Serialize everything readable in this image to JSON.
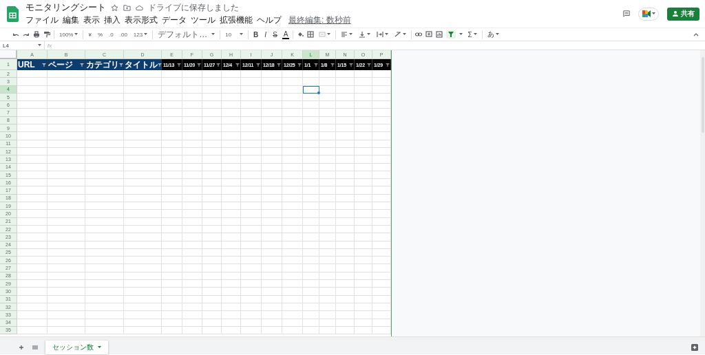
{
  "document": {
    "title": "モニタリングシート",
    "save_status": "ドライブに保存しました",
    "last_edit": "最終編集: 数秒前"
  },
  "menu": [
    "ファイル",
    "編集",
    "表示",
    "挿入",
    "表示形式",
    "データ",
    "ツール",
    "拡張機能",
    "ヘルプ"
  ],
  "share_button": "共有",
  "toolbar": {
    "zoom": "100%",
    "currency": "¥",
    "percent": "%",
    "decrease_decimal": ".0",
    "increase_decimal": ".00",
    "more_formats": "123",
    "font": "デフォルト…",
    "font_size": "10",
    "bold": "B",
    "italic": "I",
    "strikethrough": "S",
    "text_color": "A",
    "functions": "Σ",
    "input_tools": "あ",
    "filter_selected": true
  },
  "name_box": "L4",
  "formula_label": "fx",
  "columns": [
    {
      "label": "A",
      "selected": false
    },
    {
      "label": "B",
      "selected": false
    },
    {
      "label": "C",
      "selected": false
    },
    {
      "label": "D",
      "selected": false
    },
    {
      "label": "E",
      "selected": false
    },
    {
      "label": "F",
      "selected": false
    },
    {
      "label": "G",
      "selected": false
    },
    {
      "label": "H",
      "selected": false
    },
    {
      "label": "I",
      "selected": false
    },
    {
      "label": "J",
      "selected": false
    },
    {
      "label": "K",
      "selected": false
    },
    {
      "label": "L",
      "selected": true
    },
    {
      "label": "M",
      "selected": false
    },
    {
      "label": "N",
      "selected": false
    },
    {
      "label": "O",
      "selected": false
    },
    {
      "label": "P",
      "selected": false
    }
  ],
  "header_row": [
    {
      "text": "URL",
      "kind": "blue"
    },
    {
      "text": "ページ",
      "kind": "blue"
    },
    {
      "text": "カテゴリ",
      "kind": "blue"
    },
    {
      "text": "タイトル",
      "kind": "blue"
    },
    {
      "text": "11/13",
      "kind": "black"
    },
    {
      "text": "11/20",
      "kind": "black"
    },
    {
      "text": "11/27",
      "kind": "black"
    },
    {
      "text": "12/4",
      "kind": "black"
    },
    {
      "text": "12/11",
      "kind": "black"
    },
    {
      "text": "12/18",
      "kind": "black"
    },
    {
      "text": "12/25",
      "kind": "black"
    },
    {
      "text": "1/1",
      "kind": "black"
    },
    {
      "text": "1/8",
      "kind": "black"
    },
    {
      "text": "1/15",
      "kind": "black"
    },
    {
      "text": "1/22",
      "kind": "black"
    },
    {
      "text": "1/29",
      "kind": "black"
    }
  ],
  "rows": [
    {
      "label": "1",
      "selected": false
    },
    {
      "label": "2",
      "selected": false
    },
    {
      "label": "3",
      "selected": false
    },
    {
      "label": "4",
      "selected": true
    },
    {
      "label": "5",
      "selected": false
    },
    {
      "label": "6",
      "selected": false
    },
    {
      "label": "7",
      "selected": false
    },
    {
      "label": "8",
      "selected": false
    },
    {
      "label": "9",
      "selected": false
    },
    {
      "label": "10",
      "selected": false
    },
    {
      "label": "11",
      "selected": false
    },
    {
      "label": "12",
      "selected": false
    },
    {
      "label": "13",
      "selected": false
    },
    {
      "label": "14",
      "selected": false
    },
    {
      "label": "15",
      "selected": false
    },
    {
      "label": "16",
      "selected": false
    },
    {
      "label": "17",
      "selected": false
    },
    {
      "label": "18",
      "selected": false
    },
    {
      "label": "19",
      "selected": false
    },
    {
      "label": "20",
      "selected": false
    },
    {
      "label": "21",
      "selected": false
    },
    {
      "label": "22",
      "selected": false
    },
    {
      "label": "23",
      "selected": false
    },
    {
      "label": "24",
      "selected": false
    },
    {
      "label": "25",
      "selected": false
    },
    {
      "label": "26",
      "selected": false
    },
    {
      "label": "27",
      "selected": false
    },
    {
      "label": "28",
      "selected": false
    },
    {
      "label": "29",
      "selected": false
    },
    {
      "label": "30",
      "selected": false
    },
    {
      "label": "31",
      "selected": false
    },
    {
      "label": "32",
      "selected": false
    },
    {
      "label": "33",
      "selected": false
    },
    {
      "label": "34",
      "selected": false
    },
    {
      "label": "35",
      "selected": false
    }
  ],
  "sheet_tabs": [
    {
      "label": "セッション数",
      "selected": true
    }
  ]
}
